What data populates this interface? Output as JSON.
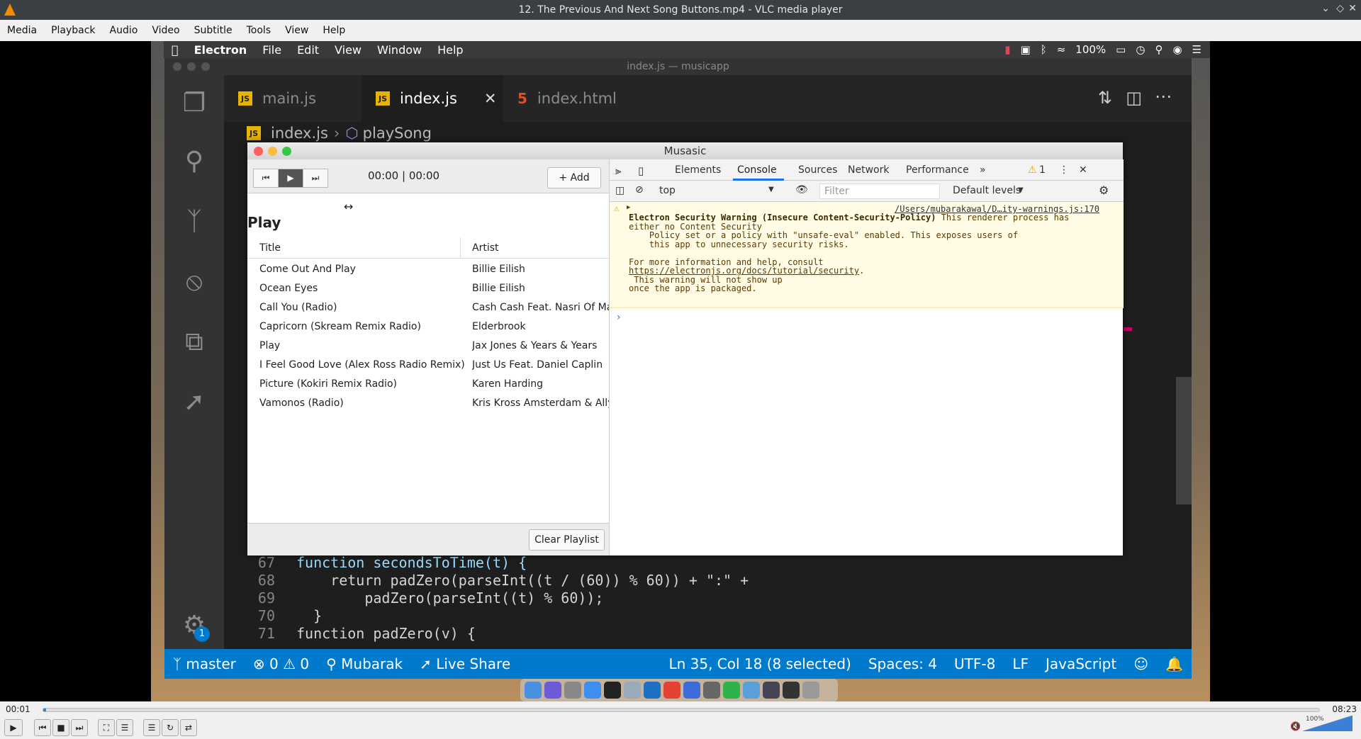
{
  "vlc": {
    "title": "12. The Previous And Next Song Buttons.mp4 - VLC media player",
    "menu": [
      "Media",
      "Playback",
      "Audio",
      "Video",
      "Subtitle",
      "Tools",
      "View",
      "Help"
    ],
    "time_elapsed": "00:01",
    "time_total": "08:23",
    "progress_fraction": 0.002,
    "volume_label": "100%"
  },
  "macbar": {
    "app": "Electron",
    "menu": [
      "File",
      "Edit",
      "View",
      "Window",
      "Help"
    ],
    "battery": "100%"
  },
  "vscode": {
    "window_title": "index.js — musicapp",
    "tabs": [
      {
        "label": "main.js",
        "type": "js"
      },
      {
        "label": "index.js",
        "type": "js"
      },
      {
        "label": "index.html",
        "type": "html"
      }
    ],
    "breadcrumb": {
      "file": "index.js",
      "symbol": "playSong"
    },
    "code_lines": [
      {
        "n": "67",
        "text": "function secondsToTime(t) {"
      },
      {
        "n": "68",
        "text": "    return padZero(parseInt((t / (60)) % 60)) + \":\" +"
      },
      {
        "n": "69",
        "text": "        padZero(parseInt((t) % 60));"
      },
      {
        "n": "70",
        "text": "  }"
      },
      {
        "n": "71",
        "text": "function padZero(v) {"
      }
    ],
    "badge_count": "1",
    "status": {
      "branch": "master",
      "errors": "0",
      "warnings": "0",
      "user": "Mubarak",
      "live_share": "Live Share",
      "position": "Ln 35, Col 18 (8 selected)",
      "spaces": "Spaces: 4",
      "encoding": "UTF-8",
      "eol": "LF",
      "language": "JavaScript"
    }
  },
  "app": {
    "title": "Musasic",
    "timer": "00:00 | 00:00",
    "add_label": "Add",
    "playing_title": "Play",
    "columns": [
      "Title",
      "Artist"
    ],
    "songs": [
      {
        "title": "Come Out And Play",
        "artist": "Billie Eilish"
      },
      {
        "title": "Ocean Eyes",
        "artist": "Billie Eilish"
      },
      {
        "title": "Call You (Radio)",
        "artist": "Cash Cash Feat. Nasri Of Mag"
      },
      {
        "title": "Capricorn (Skream Remix Radio)",
        "artist": "Elderbrook"
      },
      {
        "title": "Play",
        "artist": "Jax Jones & Years & Years"
      },
      {
        "title": "I Feel Good Love (Alex Ross Radio Remix)",
        "artist": "Just Us Feat. Daniel Caplin"
      },
      {
        "title": "Picture (Kokiri Remix Radio)",
        "artist": "Karen Harding"
      },
      {
        "title": "Vamonos (Radio)",
        "artist": "Kris Kross Amsterdam & Ally B"
      }
    ],
    "clear_label": "Clear Playlist"
  },
  "devtools": {
    "tabs": [
      "Elements",
      "Console",
      "Sources",
      "Network",
      "Performance"
    ],
    "active_tab": "Console",
    "warning_count": "1",
    "context": "top",
    "filter_placeholder": "Filter",
    "levels": "Default levels",
    "warning": {
      "source": "/Users/mubarakawal/D…ity-warnings.js:170",
      "heading": "Electron Security Warning (Insecure Content-Security-Policy)",
      "line1_rest": " This renderer process has",
      "line2": "either no Content Security",
      "line3": "    Policy set or a policy with \"unsafe-eval\" enabled. This exposes users of",
      "line4": "    this app to unnecessary security risks.",
      "line5": "For more information and help, consult",
      "link": "https://electronjs.org/docs/tutorial/security",
      "line7": " This warning will not show up",
      "line8": "once the app is packaged."
    }
  }
}
